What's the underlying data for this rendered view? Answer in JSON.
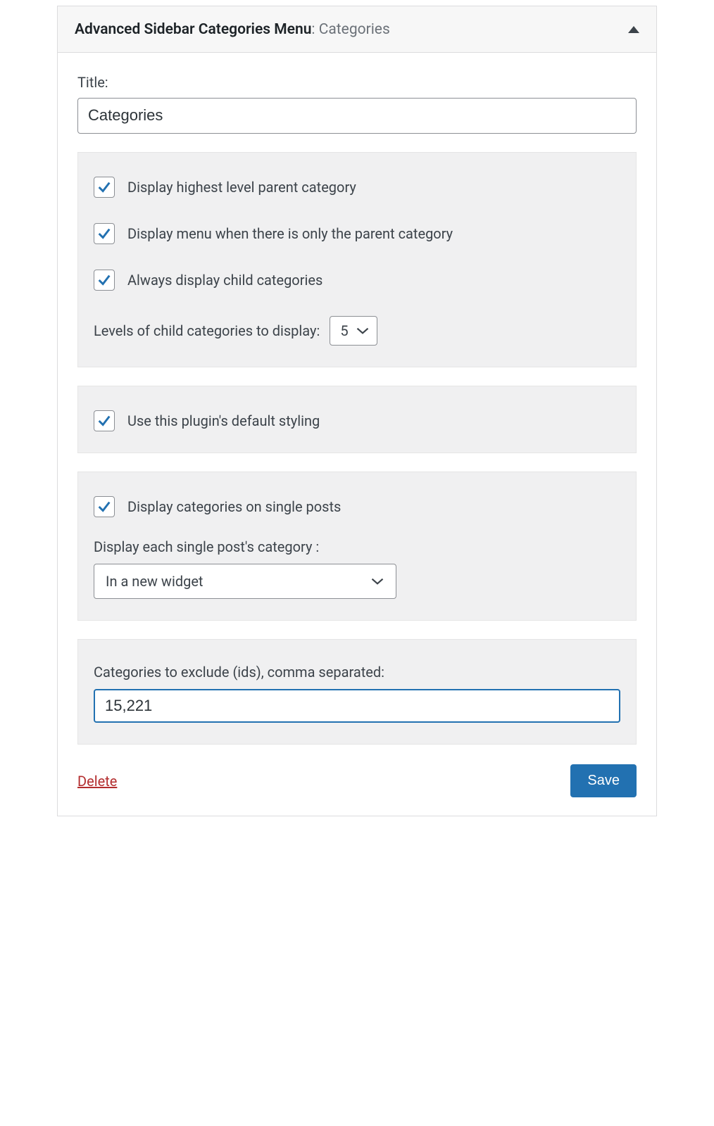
{
  "header": {
    "title_strong": "Advanced Sidebar Categories Menu",
    "title_sub": ": Categories"
  },
  "title_field": {
    "label": "Title:",
    "value": "Categories"
  },
  "section_display": {
    "opt_highest": {
      "checked": true,
      "label": "Display highest level parent category"
    },
    "opt_only_parent": {
      "checked": true,
      "label": "Display menu when there is only the parent category"
    },
    "opt_always_child": {
      "checked": true,
      "label": "Always display child categories"
    },
    "levels_label": "Levels of child categories to display:",
    "levels_value": "5"
  },
  "section_style": {
    "opt_default_style": {
      "checked": true,
      "label": "Use this plugin's default styling"
    }
  },
  "section_single": {
    "opt_single": {
      "checked": true,
      "label": "Display categories on single posts"
    },
    "display_each_label": "Display each single post's category :",
    "display_each_value": "In a new widget"
  },
  "section_exclude": {
    "label": "Categories to exclude (ids), comma separated:",
    "value": "15,221"
  },
  "footer": {
    "delete": "Delete",
    "save": "Save"
  }
}
